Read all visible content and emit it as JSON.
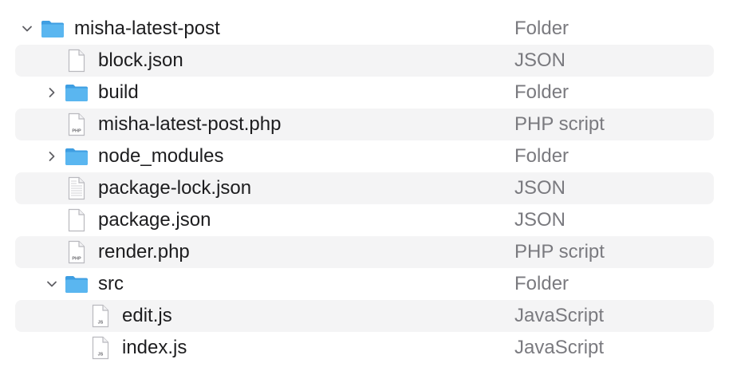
{
  "columns": {
    "kind_header": ""
  },
  "colors": {
    "folder": "#4aa8e8",
    "folder_tab": "#6cc0f4",
    "doc_outline": "#b9b9be",
    "stripe": "#f4f4f5",
    "kind_text": "#7a7a7f"
  },
  "rows": [
    {
      "name": "misha-latest-post",
      "kind": "Folder",
      "icon": "folder-icon",
      "expanded": true
    },
    {
      "name": "block.json",
      "kind": "JSON",
      "icon": "json-file-icon"
    },
    {
      "name": "build",
      "kind": "Folder",
      "icon": "folder-icon",
      "expanded": false
    },
    {
      "name": "misha-latest-post.php",
      "kind": "PHP script",
      "icon": "php-file-icon",
      "badge": "PHP"
    },
    {
      "name": "node_modules",
      "kind": "Folder",
      "icon": "folder-icon",
      "expanded": false
    },
    {
      "name": "package-lock.json",
      "kind": "JSON",
      "icon": "json-file-icon"
    },
    {
      "name": "package.json",
      "kind": "JSON",
      "icon": "json-file-icon"
    },
    {
      "name": "render.php",
      "kind": "PHP script",
      "icon": "php-file-icon",
      "badge": "PHP"
    },
    {
      "name": "src",
      "kind": "Folder",
      "icon": "folder-icon",
      "expanded": true
    },
    {
      "name": "edit.js",
      "kind": "JavaScript",
      "icon": "js-file-icon",
      "badge": "JS"
    },
    {
      "name": "index.js",
      "kind": "JavaScript",
      "icon": "js-file-icon",
      "badge": "JS"
    }
  ]
}
